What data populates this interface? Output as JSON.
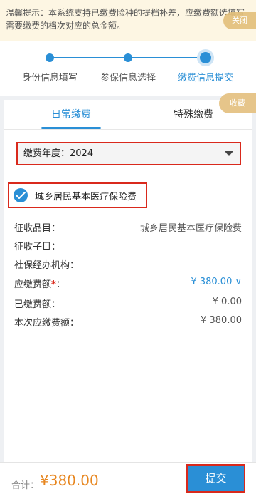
{
  "notice": {
    "text": "温馨提示：本系统支持已缴费险种的提档补差，应缴费额选填写需要缴费的档次对应的总金额。",
    "close_label": "关闭"
  },
  "steps": {
    "items": [
      "身份信息填写",
      "参保信息选择",
      "缴费信息提交"
    ],
    "current": 2
  },
  "tabs": {
    "items": [
      "日常缴费",
      "特殊缴费"
    ],
    "active": 0,
    "favorite_label": "收藏"
  },
  "form": {
    "year_select": "缴费年度：2024",
    "insurance_label": "城乡居民基本医疗保险费",
    "rows": [
      {
        "key": "征收品目：",
        "value": "城乡居民基本医疗保险费"
      },
      {
        "key": "征收子目：",
        "value": ""
      },
      {
        "key": "社保经办机构：",
        "value": ""
      },
      {
        "key": "应缴费额",
        "required": "*",
        "suffix": "：",
        "value": "¥ 380.00 ∨"
      },
      {
        "key": "已缴费额：",
        "value": "¥ 0.00"
      },
      {
        "key": "本次应缴费额：",
        "value": "¥ 380.00"
      }
    ]
  },
  "footer": {
    "total_label": "合计：",
    "total_value": "¥380.00",
    "submit_label": "提交"
  },
  "colors": {
    "primary": "#2a8fd6",
    "highlight_border": "#d9291c",
    "amount": "#e7861f",
    "notice_bg": "#fdf6e3",
    "pill": "#e3c07c"
  }
}
